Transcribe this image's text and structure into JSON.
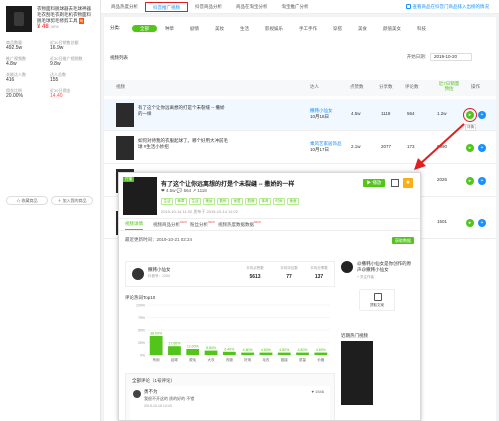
{
  "product": {
    "name": "衣物面料脱球器去毛球神器毛衣刮毛衣剃毛机衣物面料脱毛球剪毛修剪工具",
    "tag": "淘",
    "price": "¥ 48",
    "price_note": "40%",
    "stats": [
      {
        "label": "商品数量",
        "value": "492.5w"
      },
      {
        "label": "近30日销售总额",
        "value": "16.9w"
      },
      {
        "label": "推广视频数",
        "value": "4.8w"
      },
      {
        "label": "近30日推广视频数",
        "value": "9.8w"
      },
      {
        "label": "关联达人数",
        "value": "416"
      },
      {
        "label": "达人总数",
        "value": "155"
      },
      {
        "label": "佣金比例",
        "value": "20.00%"
      },
      {
        "label": "近30日佣金",
        "value": "14.40",
        "red": true
      }
    ],
    "btn_collect": "☆ 收藏商品",
    "btn_add": "＋ 加入我的商品"
  },
  "tabs": [
    "商品热度分析",
    "抖音推广视频",
    "抖音商品分析",
    "商品在淘宝分析",
    "淘宝推广分析"
  ],
  "tab_link": "查看商品在抖音门商品排入出榜的情况",
  "categories": {
    "label": "分类:",
    "items": [
      "全部",
      "种草",
      "剧情",
      "美妆",
      "生活",
      "影视娱乐",
      "手工手作",
      "穿搭",
      "美食",
      "颜值美女",
      "科技"
    ]
  },
  "list_header": "视频列表",
  "date_label": "开始日期:",
  "date_value": "2019-10-20",
  "table": {
    "headers": [
      "视频",
      "达人",
      "点赞数",
      "分享数",
      "评论数",
      "近7日销量预估",
      "操作"
    ],
    "rows": [
      {
        "title": "有了这个让你远离想的打是个未裂缝 -- 撒娇的一样",
        "author": "撒韩小仙女",
        "date": "10月18日",
        "likes": "4.5w",
        "shares": "1118",
        "comments": "564",
        "sales": "1.2w"
      },
      {
        "title": "如何对待我的衣服起球了。哪个好用大冲前毛球 #生活小妙招",
        "author": "乘风艺家居饰品",
        "date": "10月17日",
        "likes": "2.1w",
        "shares": "2077",
        "comments": "173",
        "sales": "6990"
      },
      {
        "title": "",
        "author": "",
        "date": "",
        "likes": "",
        "shares": "",
        "comments": "",
        "sales": "2026"
      },
      {
        "title": "",
        "author": "",
        "date": "",
        "likes": "",
        "shares": "",
        "comments": "",
        "sales": "1501"
      }
    ],
    "tooltip": "详情"
  },
  "popup": {
    "tag": "在播",
    "title": "有了这个让你远离想的打是个未裂缝 -- 撒娇的一样",
    "meta": "❤ 4.5w   💬 564   ↗ 1118",
    "tags": [
      "生活",
      "种草",
      "生活",
      "美妆",
      "数码",
      "家居",
      "剧情",
      "体育",
      "时尚",
      "美食"
    ],
    "time": "2019-10-14 11:02   发布于 2019-10-14 11:02",
    "play": "▶ 播放",
    "tabs": [
      {
        "label": "视频详情",
        "new": ""
      },
      {
        "label": "视频商品分析",
        "new": "NEW"
      },
      {
        "label": "粉丝分析",
        "new": "NEW"
      },
      {
        "label": "视频热度数据数据",
        "new": "NEW"
      }
    ],
    "updated": "最近更新时间：2019-10-21 02:24",
    "download": "获取数据",
    "author_name": "撒韩小仙女",
    "author_id": "抖音号：1234",
    "cols": [
      {
        "a": "平均点赞数",
        "b": "5613"
      },
      {
        "a": "平均评论数",
        "b": "77"
      },
      {
        "a": "平均分享数",
        "b": "137"
      }
    ],
    "word_title": "评论热词Top10",
    "comments_head": "全部评论（1号评论）",
    "comment": {
      "name": "勇不为",
      "text": "我很不开这的 质的好的 不错",
      "date": "2019-10-16 10:43",
      "likes": "♥ 1546"
    },
    "right_name": "@撒韩小仙女是你创作的原声@撒韩小仙女",
    "right_fans": "+ 关注作者",
    "right_btn": "提取文案",
    "hot_title": "近期热门视频"
  },
  "chart_data": {
    "type": "bar",
    "title": "评论热词Top10",
    "categories": [
      "有用",
      "起球",
      "脱毛",
      "大衣",
      "衣服",
      "好用",
      "毛衣",
      "链接",
      "质量",
      "价格"
    ],
    "values": [
      38.0,
      17.6,
      12.0,
      8.8,
      6.4,
      4.8,
      4.8,
      4.8,
      4.8,
      4.8
    ],
    "value_labels": [
      "38.00%",
      "17.60%",
      "12.00%",
      "8.80%",
      "6.40%",
      "4.80%",
      "4.80%",
      "4.80%",
      "4.80%",
      "4.80%"
    ],
    "yticks": [
      "100%",
      "75%",
      "50%",
      "25%",
      "0%"
    ],
    "ylim": [
      0,
      100
    ],
    "color": "#52c41a"
  }
}
